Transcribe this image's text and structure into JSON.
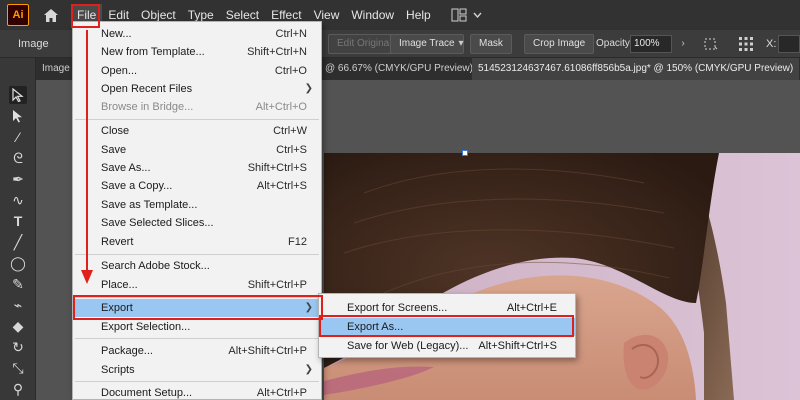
{
  "app": {
    "logo": "Ai",
    "menus": [
      "File",
      "Edit",
      "Object",
      "Type",
      "Select",
      "Effect",
      "View",
      "Window",
      "Help"
    ]
  },
  "control_bar": {
    "selection_label": "Image",
    "edit_original": "Edit Original",
    "image_trace": "Image Trace",
    "mask": "Mask",
    "crop_image": "Crop Image",
    "opacity_label": "Opacity:",
    "opacity_value": "100%",
    "x_label": "X:"
  },
  "tabs": [
    {
      "label": "Image"
    },
    {
      "label": "@ 66.67% (CMYK/GPU Preview)"
    },
    {
      "label": "514523124637467.61086ff856b5a.jpg* @ 150% (CMYK/GPU Preview)"
    }
  ],
  "file_menu": {
    "items": [
      {
        "label": "New...",
        "shortcut": "Ctrl+N"
      },
      {
        "label": "New from Template...",
        "shortcut": "Shift+Ctrl+N"
      },
      {
        "label": "Open...",
        "shortcut": "Ctrl+O"
      },
      {
        "label": "Open Recent Files",
        "shortcut": ""
      },
      {
        "label": "Browse in Bridge...",
        "shortcut": "Alt+Ctrl+O"
      },
      {
        "label": "Close",
        "shortcut": "Ctrl+W"
      },
      {
        "label": "Save",
        "shortcut": "Ctrl+S"
      },
      {
        "label": "Save As...",
        "shortcut": "Shift+Ctrl+S"
      },
      {
        "label": "Save a Copy...",
        "shortcut": "Alt+Ctrl+S"
      },
      {
        "label": "Save as Template...",
        "shortcut": ""
      },
      {
        "label": "Save Selected Slices...",
        "shortcut": ""
      },
      {
        "label": "Revert",
        "shortcut": "F12"
      },
      {
        "label": "Search Adobe Stock...",
        "shortcut": ""
      },
      {
        "label": "Place...",
        "shortcut": "Shift+Ctrl+P"
      },
      {
        "label": "Export",
        "shortcut": ""
      },
      {
        "label": "Export Selection...",
        "shortcut": ""
      },
      {
        "label": "Package...",
        "shortcut": "Alt+Shift+Ctrl+P"
      },
      {
        "label": "Scripts",
        "shortcut": ""
      },
      {
        "label": "Document Setup...",
        "shortcut": "Alt+Ctrl+P"
      }
    ]
  },
  "export_submenu": {
    "items": [
      {
        "label": "Export for Screens...",
        "shortcut": "Alt+Ctrl+E"
      },
      {
        "label": "Export As...",
        "shortcut": ""
      },
      {
        "label": "Save for Web (Legacy)...",
        "shortcut": "Alt+Shift+Ctrl+S"
      }
    ]
  },
  "colors": {
    "menu_highlight": "#99c7f2",
    "annotation_red": "#e0201b",
    "app_accent": "#ff9a00"
  }
}
